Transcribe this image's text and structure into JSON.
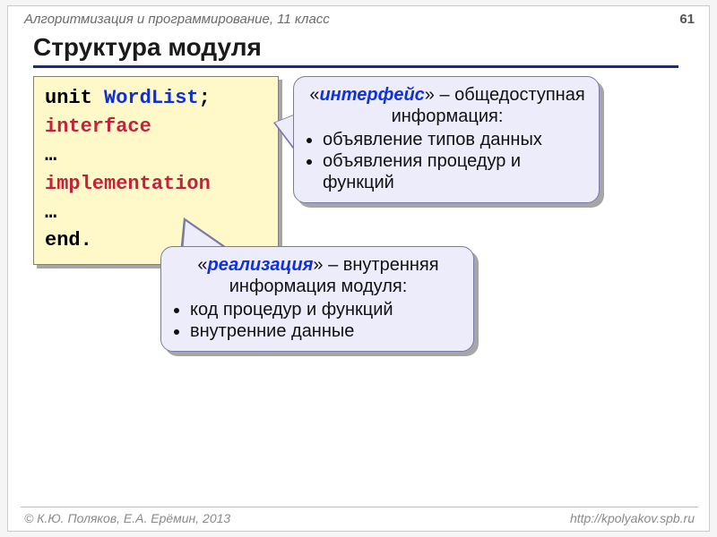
{
  "header": {
    "subject": "Алгоритмизация и программирование, 11 класс",
    "page": "61"
  },
  "title": "Структура модуля",
  "code": {
    "l1a": "unit ",
    "l1b": "WordList",
    "l1c": ";",
    "l2": "interface",
    "l3": "  …",
    "l4": "implementation",
    "l5": "  …",
    "l6": "end."
  },
  "callout1": {
    "q1": "«",
    "term": "интерфейс",
    "q2": "» – общедоступная информация:",
    "b1": "объявление типов данных",
    "b2": "объявления процедур и функций"
  },
  "callout2": {
    "q1": "«",
    "term": "реализация",
    "q2": "» –  внутренняя информация модуля:",
    "b1": "код процедур и функций",
    "b2": "внутренние данные"
  },
  "footer": {
    "left": "© К.Ю. Поляков, Е.А. Ерёмин, 2013",
    "right": "http://kpolyakov.spb.ru"
  }
}
